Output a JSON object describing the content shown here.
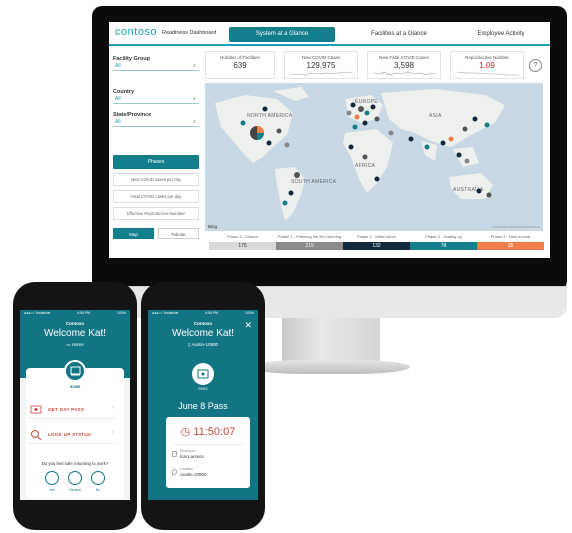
{
  "dashboard": {
    "brand": "contoso",
    "readiness": "Readiness Dashboard",
    "tabs": [
      "System at a Glance",
      "Facilities at a Glance",
      "Employee Activity"
    ],
    "active_tab": 0
  },
  "filters": {
    "facility_group": {
      "label": "Facility Group",
      "value": "All"
    },
    "country": {
      "label": "Country",
      "value": "All"
    },
    "state": {
      "label": "State/Province",
      "value": "All"
    },
    "metrics": [
      "Phases",
      "New COVID cases per day",
      "Fatal COVID cases per day",
      "Effective Reproductive Number"
    ],
    "active_metric": 0,
    "view_toggle": [
      "Map",
      "Tabular"
    ],
    "active_view": 0
  },
  "kpis": [
    {
      "label": "Number of Facilities",
      "value": "639"
    },
    {
      "label": "New COVID Cases",
      "value": "129,975"
    },
    {
      "label": "New Fatal COVID Cases",
      "value": "3,598"
    },
    {
      "label": "Reproductive Number",
      "value": "1.09"
    }
  ],
  "help_icon": "?",
  "map": {
    "labels": [
      "NORTH AMERICA",
      "EUROPE",
      "ASIA",
      "AFRICA",
      "SOUTH AMERICA",
      "AUSTRALIA"
    ],
    "provider": "Bing",
    "copyright": "© 2020 Microsoft Corporation  Terms"
  },
  "phases": [
    {
      "label": "Phase 0 - Closed",
      "count": "175",
      "color": "#d9d9d9",
      "text_color": "#333333"
    },
    {
      "label": "Phase 1 - Planning the Re-Opening",
      "count": "219",
      "color": "#8a8a8a",
      "text_color": "#ffffff"
    },
    {
      "label": "Phase 2 - Initial return",
      "count": "132",
      "color": "#13293d",
      "text_color": "#ffffff"
    },
    {
      "label": "Phase 3 - Scaling up",
      "count": "78",
      "color": "#137e8c",
      "text_color": "#ffffff"
    },
    {
      "label": "Phase 4 - New normal",
      "count": "35",
      "color": "#f07f4c",
      "text_color": "#ffffff"
    }
  ],
  "phone1": {
    "status_left": "●●●○○ Vodafone",
    "status_time": "4:00 PM",
    "status_right": "100%",
    "company": "Contoso",
    "welcome": "Welcome Kat!",
    "location": "Home",
    "home_label": "HOME",
    "menu": [
      "GET DAY PASS",
      "LOOK UP STATUS"
    ],
    "question": "Do you feel safe returning to work?",
    "answers": [
      "Yes",
      "Neutral",
      "No"
    ]
  },
  "phone2": {
    "status_left": "●●●○○ Vodafone",
    "status_time": "4:00 PM",
    "status_right": "100%",
    "company": "Contoso",
    "welcome": "Welcome Kat!",
    "location": "Austin-10900",
    "pass_label": "PASS",
    "pass_title": "June 8 Pass",
    "time": "11:50:07",
    "employee_caption": "Employee",
    "employee": "Kat Larsson",
    "location_caption": "Location",
    "location_value": "Austin-10900"
  }
}
